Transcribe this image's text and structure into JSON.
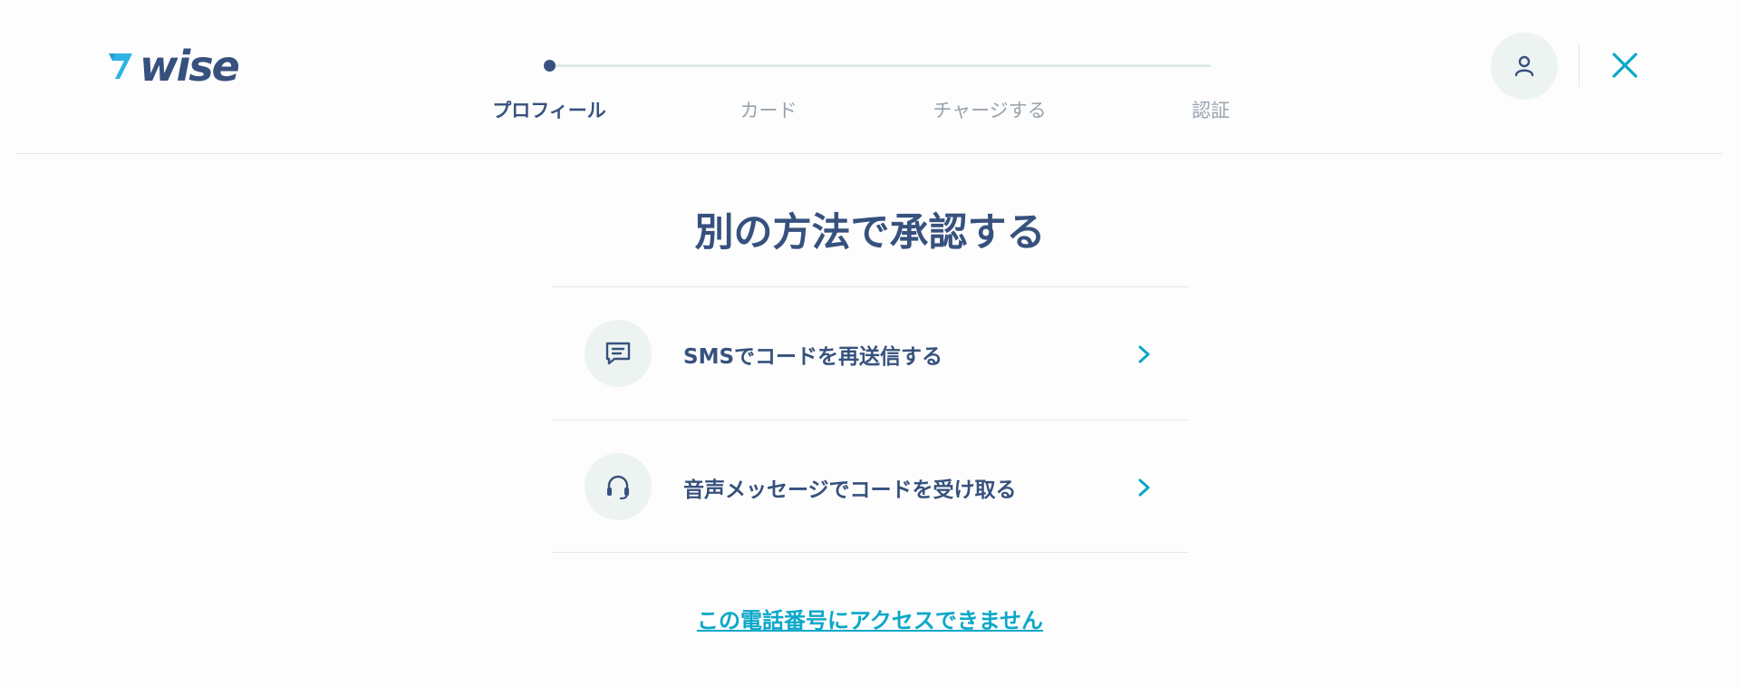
{
  "brand": {
    "logo_text": "wise"
  },
  "stepper": {
    "steps": [
      {
        "label": "プロフィール",
        "active": true
      },
      {
        "label": "カード",
        "active": false
      },
      {
        "label": "チャージする",
        "active": false
      },
      {
        "label": "認証",
        "active": false
      }
    ]
  },
  "header": {
    "avatar_icon": "user-icon",
    "close_icon": "close-icon"
  },
  "main": {
    "title": "別の方法で承認する",
    "options": [
      {
        "label": "SMSでコードを再送信する",
        "icon": "message-icon"
      },
      {
        "label": "音声メッセージでコードを受け取る",
        "icon": "headset-icon"
      }
    ],
    "link_text": "この電話番号にアクセスできません"
  },
  "colors": {
    "primary": "#37517e",
    "accent": "#0aa8c9",
    "icon_bg": "#edf3f1"
  }
}
